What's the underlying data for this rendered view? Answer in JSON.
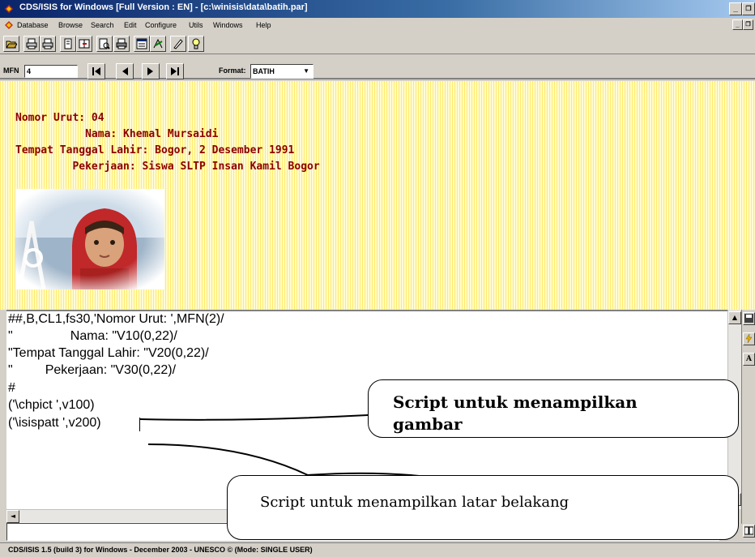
{
  "window": {
    "title": "CDS/ISIS for Windows [Full Version : EN] - [c:\\winisis\\data\\batih.par]",
    "controls": [
      "_",
      " &#x25A1;"
    ]
  },
  "menu": {
    "items": [
      "Database",
      "Browse",
      "Search",
      "Edit",
      "Configure",
      "Utils",
      "Windows",
      "Help"
    ]
  },
  "toolbar": {
    "buttons": [
      "open-icon",
      "print-txt-icon",
      "print-rtf-icon",
      "copy-icon",
      "export-icon",
      "preview-icon",
      "print-icon",
      "form-icon",
      "sort-icon",
      "pen-icon",
      "bulb-icon"
    ]
  },
  "nav": {
    "mfn_label": "MFN",
    "mfn_value": "4",
    "format_label": "Format:",
    "format_value": "BATIH",
    "buttons": [
      "first-record-icon",
      "previous-record-icon",
      "next-record-icon",
      "last-record-icon"
    ]
  },
  "record": {
    "line1": "Nomor Urut: 04",
    "line2": "           Nama: Khemal Mursaidi",
    "line3": "Tempat Tanggal Lahir: Bogor, 2 Desember 1991",
    "line4": "         Pekerjaan: Siswa SLTP Insan Kamil Bogor"
  },
  "editor": {
    "lines": [
      "##,B,CL1,fs30,'Nomor Urut: ',MFN(2)/",
      "\"                Nama: \"V10(0,22)/",
      "\"Tempat Tanggal Lahir: \"V20(0,22)/",
      "\"         Pekerjaan: \"V30(0,22)/",
      "#",
      "('\\chpict ',v100)",
      "('\\isispatt ',v200)"
    ]
  },
  "callouts": {
    "picture": "Script untuk menampilkan gambar",
    "background": "Script untuk menampilkan latar belakang"
  },
  "status": {
    "text": "CDS/ISIS 1.5 (build 3) for Windows - December 2003 - UNESCO © (Mode: SINGLE USER)"
  },
  "colors": {
    "record_text": "#8b0000",
    "titlebar": "#0a246a",
    "display_bg": "#fff6a8"
  }
}
